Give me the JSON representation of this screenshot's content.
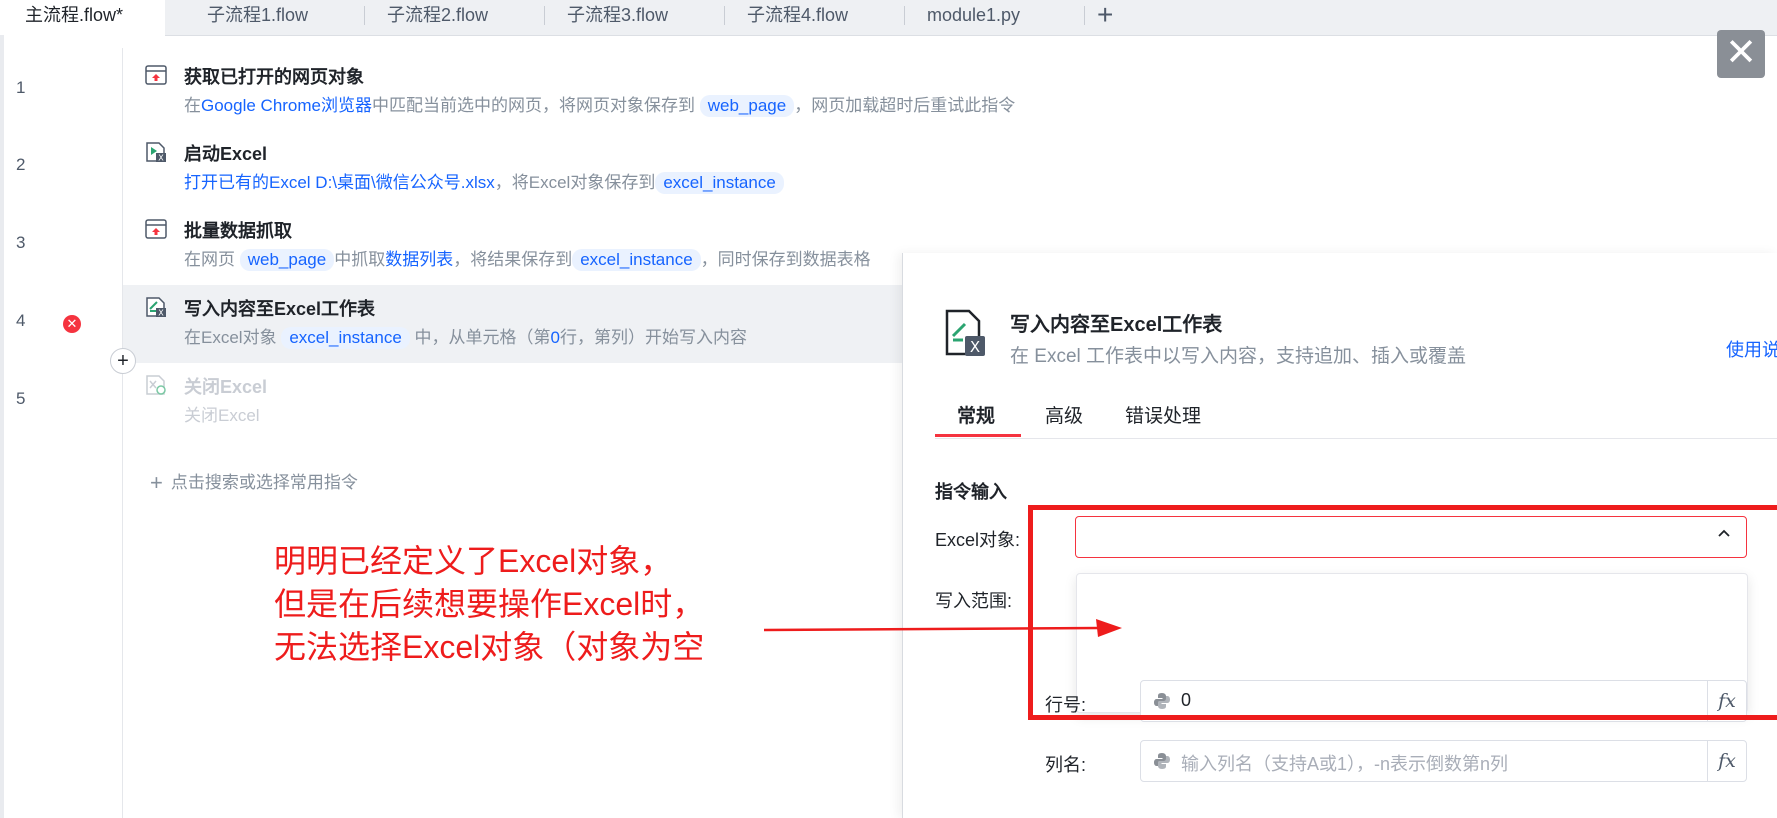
{
  "tabs": [
    {
      "label": "主流程.flow*",
      "active": true
    },
    {
      "label": "子流程1.flow"
    },
    {
      "label": "子流程2.flow"
    },
    {
      "label": "子流程3.flow"
    },
    {
      "label": "子流程4.flow"
    },
    {
      "label": "module1.py"
    }
  ],
  "tab_add": "+",
  "close_button": "✕",
  "steps": [
    {
      "line": "1",
      "icon": "browser-icon",
      "title": "获取已打开的网页对象",
      "desc": {
        "p1": "在",
        "link1": "Google Chrome浏览器",
        "p2": "中匹配当前选中的网页，将网页对象保存到",
        "var1": "web_page",
        "p3": "，网页加载超时后重试此指令"
      }
    },
    {
      "line": "2",
      "icon": "excel-launch-icon",
      "title": "启动Excel",
      "desc": {
        "link1": "打开已有的Excel D:\\桌面\\微信公众号.xlsx",
        "p1": "，将Excel对象保存到",
        "var1": "excel_instance"
      }
    },
    {
      "line": "3",
      "icon": "browser-icon",
      "title": "批量数据抓取",
      "desc": {
        "p1": "在网页",
        "var1": "web_page",
        "p2": "中抓取",
        "link1": "数据列表",
        "p3": "，将结果保存到",
        "var2": "excel_instance",
        "p4": "，同时保存到数据表格"
      }
    },
    {
      "line": "4",
      "icon": "excel-write-icon",
      "title": "写入内容至Excel工作表",
      "error": "✕",
      "desc": {
        "p1": "在Excel对象",
        "var1": "excel_instance",
        "p2": "中，从单元格（第",
        "link1": "0",
        "p3": "行，第列）开始写入内容"
      }
    },
    {
      "line": "5",
      "icon": "excel-close-icon",
      "title": "关闭Excel",
      "disabled": true,
      "desc": {
        "p1": "关闭Excel"
      }
    }
  ],
  "insert_button": "+",
  "add_command": {
    "plus": "+",
    "label": "点击搜索或选择常用指令"
  },
  "annotation": {
    "line1": "明明已经定义了Excel对象，",
    "line2": "但是在后续想要操作Excel时，",
    "line3": "无法选择Excel对象（对象为空"
  },
  "panel": {
    "title": "写入内容至Excel工作表",
    "subtitle": "在 Excel 工作表中以写入内容，支持追加、插入或覆盖",
    "help_link": "使用说",
    "tabs": [
      "常规",
      "高级",
      "错误处理"
    ],
    "section": "指令输入",
    "fields": {
      "excel_object": {
        "label": "Excel对象:",
        "value": "",
        "chevron": "^"
      },
      "write_range": {
        "label": "写入范围:"
      },
      "row": {
        "label": "行号:",
        "value": "0",
        "fx": "fx"
      },
      "col": {
        "label": "列名:",
        "placeholder": "输入列名（支持A或1），-n表示倒数第n列",
        "fx": "fx"
      }
    }
  },
  "colors": {
    "accent": "#1664ff",
    "error": "#f5333f",
    "annotation": "#ee1c1c"
  }
}
